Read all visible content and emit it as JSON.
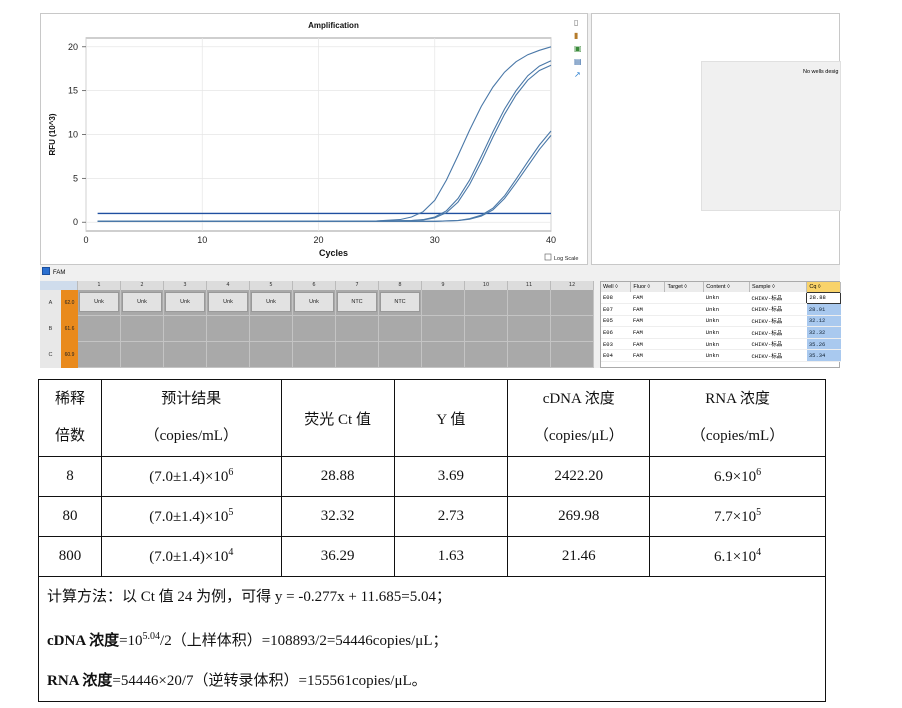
{
  "chart_data": {
    "type": "line",
    "title": "Amplification",
    "xlabel": "Cycles",
    "ylabel": "RFU (10^3)",
    "xlim": [
      0,
      40
    ],
    "ylim": [
      -1,
      21
    ],
    "xticks": [
      0,
      10,
      20,
      30,
      40
    ],
    "yticks": [
      0,
      5,
      10,
      15,
      20
    ],
    "threshold": 1.0,
    "series": [
      {
        "x": [
          1,
          5,
          10,
          15,
          20,
          25,
          27,
          28,
          29,
          30,
          31,
          32,
          33,
          34,
          35,
          36,
          37,
          38,
          39,
          40
        ],
        "values": [
          0.1,
          0.1,
          0.1,
          0.1,
          0.1,
          0.15,
          0.3,
          0.6,
          1.2,
          2.5,
          4.8,
          7.6,
          10.5,
          13.2,
          15.4,
          17.1,
          18.3,
          19.1,
          19.6,
          20.0
        ]
      },
      {
        "x": [
          1,
          5,
          10,
          15,
          20,
          25,
          28,
          29,
          30,
          31,
          32,
          33,
          34,
          35,
          36,
          37,
          38,
          39,
          40
        ],
        "values": [
          0.1,
          0.1,
          0.1,
          0.1,
          0.1,
          0.12,
          0.2,
          0.3,
          0.6,
          1.3,
          2.7,
          4.8,
          7.5,
          10.3,
          12.9,
          15.0,
          16.7,
          17.8,
          18.4
        ]
      },
      {
        "x": [
          1,
          5,
          10,
          15,
          20,
          25,
          28,
          29,
          30,
          31,
          32,
          33,
          34,
          35,
          36,
          37,
          38,
          39,
          40
        ],
        "values": [
          0.1,
          0.1,
          0.1,
          0.1,
          0.1,
          0.12,
          0.18,
          0.25,
          0.5,
          1.1,
          2.3,
          4.3,
          6.9,
          9.7,
          12.3,
          14.5,
          16.2,
          17.3,
          17.9
        ]
      },
      {
        "x": [
          1,
          5,
          10,
          15,
          20,
          25,
          30,
          32,
          33,
          34,
          35,
          36,
          37,
          38,
          39,
          40
        ],
        "values": [
          0.1,
          0.1,
          0.1,
          0.1,
          0.1,
          0.1,
          0.1,
          0.2,
          0.4,
          0.8,
          1.6,
          3.0,
          4.9,
          6.9,
          8.8,
          10.4
        ]
      },
      {
        "x": [
          1,
          5,
          10,
          15,
          20,
          25,
          30,
          32,
          33,
          34,
          35,
          36,
          37,
          38,
          39,
          40
        ],
        "values": [
          0.1,
          0.1,
          0.1,
          0.1,
          0.1,
          0.1,
          0.1,
          0.18,
          0.35,
          0.7,
          1.4,
          2.7,
          4.5,
          6.4,
          8.3,
          9.9
        ]
      }
    ],
    "log_scale_label": "Log Scale"
  },
  "right_panel": {
    "message": "No wells desig"
  },
  "fluor": {
    "label": "FAM"
  },
  "plate": {
    "columns": [
      "1",
      "2",
      "3",
      "4",
      "5",
      "6",
      "7",
      "8",
      "9",
      "10",
      "11",
      "12"
    ],
    "rows": [
      {
        "label": "A",
        "value": "62.0",
        "wells": [
          "Unk",
          "Unk",
          "Unk",
          "Unk",
          "Unk",
          "Unk",
          "NTC",
          "NTC"
        ]
      },
      {
        "label": "B",
        "value": "61.6",
        "wells": []
      },
      {
        "label": "C",
        "value": "60.9",
        "wells": []
      }
    ]
  },
  "well_table": {
    "headers": [
      "Well",
      "Fluor",
      "Target",
      "Content",
      "Sample",
      "Cq"
    ],
    "rows": [
      [
        "E08",
        "FAM",
        "",
        "Unkn",
        "CHIKV-标品",
        "28.88"
      ],
      [
        "E07",
        "FAM",
        "",
        "Unkn",
        "CHIKV-标品",
        "28.91"
      ],
      [
        "E05",
        "FAM",
        "",
        "Unkn",
        "CHIKV-标品",
        "32.12"
      ],
      [
        "E06",
        "FAM",
        "",
        "Unkn",
        "CHIKV-标品",
        "32.32"
      ],
      [
        "E03",
        "FAM",
        "",
        "Unkn",
        "CHIKV-标品",
        "35.26"
      ],
      [
        "E04",
        "FAM",
        "",
        "Unkn",
        "CHIKV-标品",
        "35.34"
      ]
    ]
  },
  "results_table": {
    "headers": {
      "h1a": "稀释",
      "h1b": "倍数",
      "h2a": "预计结果",
      "h2b": "（copies/mL）",
      "h3": "荧光 Ct 值",
      "h4": "Y 值",
      "h5a": "cDNA 浓度",
      "h5b": "（copies/μL）",
      "h6a": "RNA 浓度",
      "h6b": "（copies/mL）"
    },
    "rows": [
      {
        "dilution": "8",
        "expected_base": "(7.0±1.4)×10",
        "expected_exp": "6",
        "ct": "28.88",
        "y": "3.69",
        "cdna": "2422.20",
        "rna_base": "6.9×10",
        "rna_exp": "6"
      },
      {
        "dilution": "80",
        "expected_base": "(7.0±1.4)×10",
        "expected_exp": "5",
        "ct": "32.32",
        "y": "2.73",
        "cdna": "269.98",
        "rna_base": "7.7×10",
        "rna_exp": "5"
      },
      {
        "dilution": "800",
        "expected_base": "(7.0±1.4)×10",
        "expected_exp": "4",
        "ct": "36.29",
        "y": "1.63",
        "cdna": "21.46",
        "rna_base": "6.1×10",
        "rna_exp": "4"
      }
    ],
    "notes": {
      "line1": "计算方法：以 Ct 值 24 为例，可得 y = -0.277x + 11.685=5.04；",
      "line2_label": "cDNA 浓度",
      "line2_pre": "=10",
      "line2_exp": "5.04",
      "line2_rest": "/2（上样体积）=108893/2=54446copies/μL；",
      "line3_label": "RNA 浓度",
      "line3_rest": "=54446×20/7（逆转录体积）=155561copies/μL。"
    }
  },
  "colors": {
    "curve": "#4a78a8",
    "threshold": "#1f4fa0",
    "cq_highlight": "#a9c9ef",
    "plate_orange": "#e98a1c"
  }
}
